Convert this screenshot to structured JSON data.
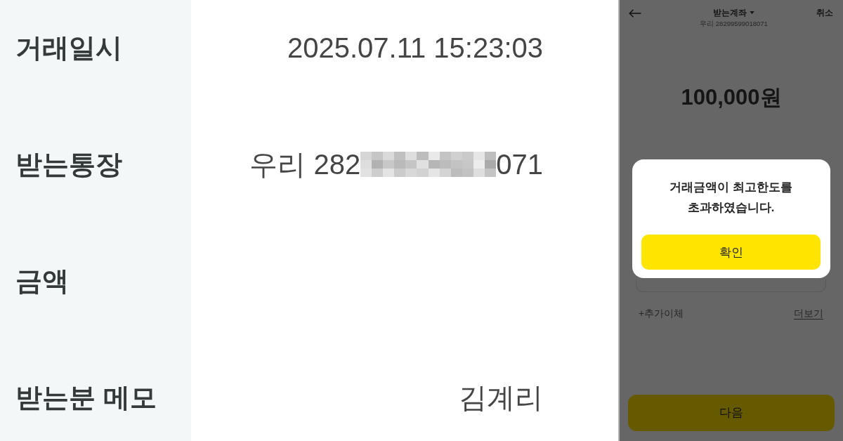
{
  "receipt": {
    "rows": [
      {
        "label": "거래일시",
        "value": "2025.07.11 15:23:03"
      },
      {
        "label": "받는통장",
        "masked_value": {
          "start": "우리 282",
          "end": "071"
        }
      },
      {
        "label": "금액"
      },
      {
        "label": "받는분 메모",
        "value": "김계리"
      }
    ]
  },
  "transfer_screen": {
    "title": "받는계좌",
    "account": "우리 28299599018071",
    "cancel": "취소",
    "amount": "100,000원",
    "add_transfer": "+추가이체",
    "more_link": "더보기",
    "next_button": "다음"
  },
  "dialog": {
    "message": "거래금액이 최고한도를 초과하였습니다.",
    "confirm_button": "확인"
  }
}
